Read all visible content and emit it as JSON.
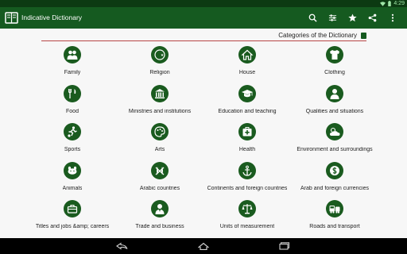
{
  "status": {
    "time": "4:29"
  },
  "app": {
    "title": "Indicative Dictionary"
  },
  "toolbar": {
    "actions": [
      {
        "name": "search-icon"
      },
      {
        "name": "settings-sliders-icon"
      },
      {
        "name": "star-icon"
      },
      {
        "name": "share-icon"
      },
      {
        "name": "overflow-menu-icon"
      }
    ]
  },
  "section": {
    "title": "Categories of the Dictionary"
  },
  "categories": [
    {
      "label": "Family",
      "icon": "family-icon"
    },
    {
      "label": "Religion",
      "icon": "religion-icon"
    },
    {
      "label": "House",
      "icon": "house-icon"
    },
    {
      "label": "Clothing",
      "icon": "clothing-icon"
    },
    {
      "label": "Food",
      "icon": "food-icon"
    },
    {
      "label": "Ministries and institutions",
      "icon": "ministries-icon"
    },
    {
      "label": "Education and teaching",
      "icon": "education-icon"
    },
    {
      "label": "Qualities and situations",
      "icon": "qualities-icon"
    },
    {
      "label": "Sports",
      "icon": "sports-icon"
    },
    {
      "label": "Arts",
      "icon": "arts-icon"
    },
    {
      "label": "Health",
      "icon": "health-icon"
    },
    {
      "label": "Environment and surroundings",
      "icon": "environment-icon"
    },
    {
      "label": "Animals",
      "icon": "animals-icon"
    },
    {
      "label": "Arabic countries",
      "icon": "arabic-countries-icon"
    },
    {
      "label": "Continents and foreign countries",
      "icon": "continents-icon"
    },
    {
      "label": "Arab and foreign currencies",
      "icon": "currencies-icon"
    },
    {
      "label": "Titles and jobs &amp; careers",
      "icon": "titles-jobs-icon"
    },
    {
      "label": "Trade and business",
      "icon": "trade-icon"
    },
    {
      "label": "Units of measurement",
      "icon": "units-icon"
    },
    {
      "label": "Roads and transport",
      "icon": "transport-icon"
    }
  ],
  "navigation": [
    {
      "name": "back-icon"
    },
    {
      "name": "home-icon"
    },
    {
      "name": "recent-apps-icon"
    }
  ],
  "colors": {
    "status_bar": "#0c3a12",
    "action_bar": "#155a20",
    "icon_circle": "#1a5b1f",
    "divider": "#b84646"
  }
}
